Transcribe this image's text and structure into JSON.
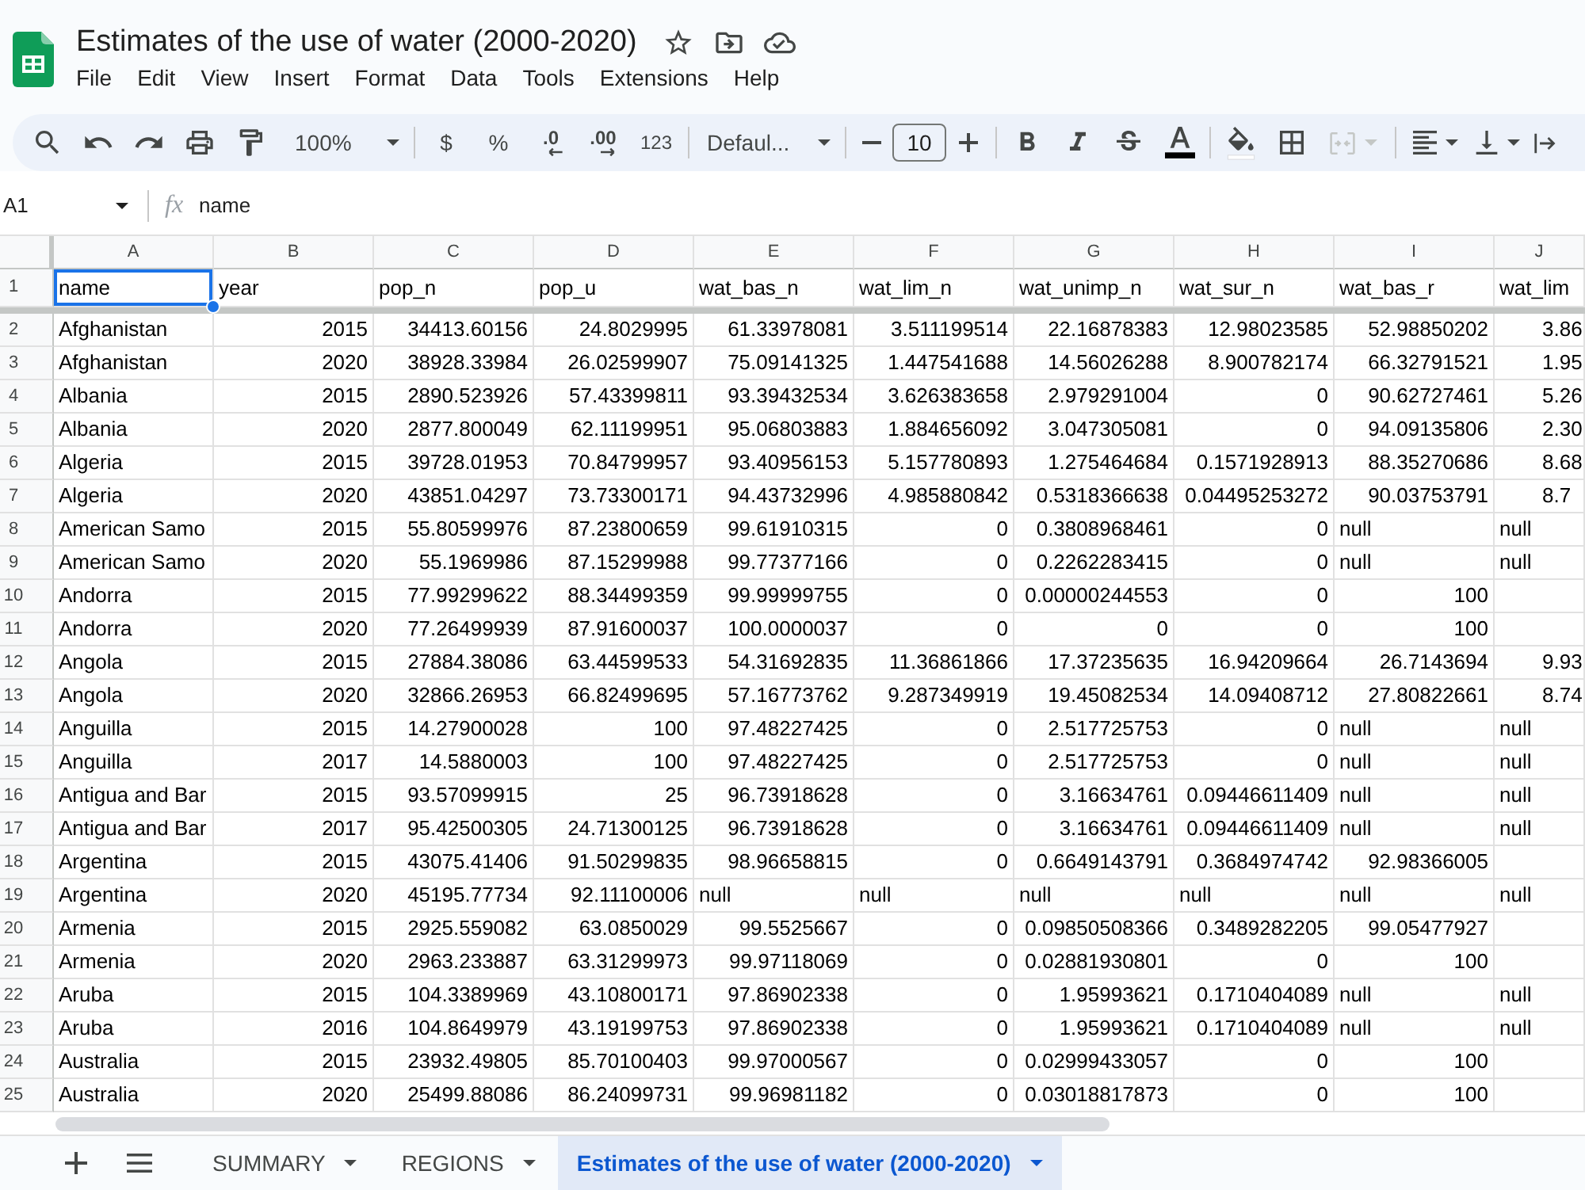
{
  "title_bar": {
    "title": "Estimates of the use of water (2000-2020)",
    "menu": [
      "File",
      "Edit",
      "View",
      "Insert",
      "Format",
      "Data",
      "Tools",
      "Extensions",
      "Help"
    ]
  },
  "toolbar": {
    "zoom": "100%",
    "currency": "$",
    "percent": "%",
    "decrease_decimal": ".0",
    "increase_decimal": ".00",
    "number_format": "123",
    "font": "Defaul...",
    "font_size": "10",
    "merge_cells": {
      "disabled": true
    }
  },
  "formula_bar": {
    "cell_reference": "A1",
    "function_label": "fx",
    "value": "name"
  },
  "grid": {
    "columns": [
      "A",
      "B",
      "C",
      "D",
      "E",
      "F",
      "G",
      "H",
      "I",
      "J"
    ],
    "rows": [
      {
        "number": "1",
        "cells": [
          {
            "text": "name",
            "kind": "text",
            "selected": true
          },
          {
            "text": "year",
            "kind": "text",
            "selected": false
          },
          {
            "text": "pop_n",
            "kind": "text",
            "selected": false
          },
          {
            "text": "pop_u",
            "kind": "text",
            "selected": false
          },
          {
            "text": "wat_bas_n",
            "kind": "text",
            "selected": false
          },
          {
            "text": "wat_lim_n",
            "kind": "text",
            "selected": false
          },
          {
            "text": "wat_unimp_n",
            "kind": "text",
            "selected": false
          },
          {
            "text": "wat_sur_n",
            "kind": "text",
            "selected": false
          },
          {
            "text": "wat_bas_r",
            "kind": "text",
            "selected": false
          },
          {
            "text": "wat_lim",
            "kind": "text",
            "selected": false
          }
        ]
      },
      {
        "number": "2",
        "cells": [
          {
            "text": "Afghanistan",
            "kind": "text",
            "selected": false
          },
          {
            "text": "2015",
            "kind": "number",
            "selected": false
          },
          {
            "text": "34413.60156",
            "kind": "number",
            "selected": false
          },
          {
            "text": "24.8029995",
            "kind": "number",
            "selected": false
          },
          {
            "text": "61.33978081",
            "kind": "number",
            "selected": false
          },
          {
            "text": "3.511199514",
            "kind": "number",
            "selected": false
          },
          {
            "text": "22.16878383",
            "kind": "number",
            "selected": false
          },
          {
            "text": "12.98023585",
            "kind": "number",
            "selected": false
          },
          {
            "text": "52.98850202",
            "kind": "number",
            "selected": false
          },
          {
            "text": "3.86",
            "kind": "number",
            "selected": false
          }
        ]
      },
      {
        "number": "3",
        "cells": [
          {
            "text": "Afghanistan",
            "kind": "text",
            "selected": false
          },
          {
            "text": "2020",
            "kind": "number",
            "selected": false
          },
          {
            "text": "38928.33984",
            "kind": "number",
            "selected": false
          },
          {
            "text": "26.02599907",
            "kind": "number",
            "selected": false
          },
          {
            "text": "75.09141325",
            "kind": "number",
            "selected": false
          },
          {
            "text": "1.447541688",
            "kind": "number",
            "selected": false
          },
          {
            "text": "14.56026288",
            "kind": "number",
            "selected": false
          },
          {
            "text": "8.900782174",
            "kind": "number",
            "selected": false
          },
          {
            "text": "66.32791521",
            "kind": "number",
            "selected": false
          },
          {
            "text": "1.95",
            "kind": "number",
            "selected": false
          }
        ]
      },
      {
        "number": "4",
        "cells": [
          {
            "text": "Albania",
            "kind": "text",
            "selected": false
          },
          {
            "text": "2015",
            "kind": "number",
            "selected": false
          },
          {
            "text": "2890.523926",
            "kind": "number",
            "selected": false
          },
          {
            "text": "57.43399811",
            "kind": "number",
            "selected": false
          },
          {
            "text": "93.39432534",
            "kind": "number",
            "selected": false
          },
          {
            "text": "3.626383658",
            "kind": "number",
            "selected": false
          },
          {
            "text": "2.979291004",
            "kind": "number",
            "selected": false
          },
          {
            "text": "0",
            "kind": "number",
            "selected": false
          },
          {
            "text": "90.62727461",
            "kind": "number",
            "selected": false
          },
          {
            "text": "5.26",
            "kind": "number",
            "selected": false
          }
        ]
      },
      {
        "number": "5",
        "cells": [
          {
            "text": "Albania",
            "kind": "text",
            "selected": false
          },
          {
            "text": "2020",
            "kind": "number",
            "selected": false
          },
          {
            "text": "2877.800049",
            "kind": "number",
            "selected": false
          },
          {
            "text": "62.11199951",
            "kind": "number",
            "selected": false
          },
          {
            "text": "95.06803883",
            "kind": "number",
            "selected": false
          },
          {
            "text": "1.884656092",
            "kind": "number",
            "selected": false
          },
          {
            "text": "3.047305081",
            "kind": "number",
            "selected": false
          },
          {
            "text": "0",
            "kind": "number",
            "selected": false
          },
          {
            "text": "94.09135806",
            "kind": "number",
            "selected": false
          },
          {
            "text": "2.30",
            "kind": "number",
            "selected": false
          }
        ]
      },
      {
        "number": "6",
        "cells": [
          {
            "text": "Algeria",
            "kind": "text",
            "selected": false
          },
          {
            "text": "2015",
            "kind": "number",
            "selected": false
          },
          {
            "text": "39728.01953",
            "kind": "number",
            "selected": false
          },
          {
            "text": "70.84799957",
            "kind": "number",
            "selected": false
          },
          {
            "text": "93.40956153",
            "kind": "number",
            "selected": false
          },
          {
            "text": "5.157780893",
            "kind": "number",
            "selected": false
          },
          {
            "text": "1.275464684",
            "kind": "number",
            "selected": false
          },
          {
            "text": "0.1571928913",
            "kind": "number",
            "selected": false
          },
          {
            "text": "88.35270686",
            "kind": "number",
            "selected": false
          },
          {
            "text": "8.68",
            "kind": "number",
            "selected": false
          }
        ]
      },
      {
        "number": "7",
        "cells": [
          {
            "text": "Algeria",
            "kind": "text",
            "selected": false
          },
          {
            "text": "2020",
            "kind": "number",
            "selected": false
          },
          {
            "text": "43851.04297",
            "kind": "number",
            "selected": false
          },
          {
            "text": "73.73300171",
            "kind": "number",
            "selected": false
          },
          {
            "text": "94.43732996",
            "kind": "number",
            "selected": false
          },
          {
            "text": "4.985880842",
            "kind": "number",
            "selected": false
          },
          {
            "text": "0.5318366638",
            "kind": "number",
            "selected": false
          },
          {
            "text": "0.04495253272",
            "kind": "number",
            "selected": false
          },
          {
            "text": "90.03753791",
            "kind": "number",
            "selected": false
          },
          {
            "text": "8.7",
            "kind": "number",
            "selected": false
          }
        ]
      },
      {
        "number": "8",
        "cells": [
          {
            "text": "American Samo",
            "kind": "text",
            "selected": false
          },
          {
            "text": "2015",
            "kind": "number",
            "selected": false
          },
          {
            "text": "55.80599976",
            "kind": "number",
            "selected": false
          },
          {
            "text": "87.23800659",
            "kind": "number",
            "selected": false
          },
          {
            "text": "99.61910315",
            "kind": "number",
            "selected": false
          },
          {
            "text": "0",
            "kind": "number",
            "selected": false
          },
          {
            "text": "0.3808968461",
            "kind": "number",
            "selected": false
          },
          {
            "text": "0",
            "kind": "number",
            "selected": false
          },
          {
            "text": "null",
            "kind": "text",
            "selected": false
          },
          {
            "text": "null",
            "kind": "text",
            "selected": false
          }
        ]
      },
      {
        "number": "9",
        "cells": [
          {
            "text": "American Samo",
            "kind": "text",
            "selected": false
          },
          {
            "text": "2020",
            "kind": "number",
            "selected": false
          },
          {
            "text": "55.1969986",
            "kind": "number",
            "selected": false
          },
          {
            "text": "87.15299988",
            "kind": "number",
            "selected": false
          },
          {
            "text": "99.77377166",
            "kind": "number",
            "selected": false
          },
          {
            "text": "0",
            "kind": "number",
            "selected": false
          },
          {
            "text": "0.2262283415",
            "kind": "number",
            "selected": false
          },
          {
            "text": "0",
            "kind": "number",
            "selected": false
          },
          {
            "text": "null",
            "kind": "text",
            "selected": false
          },
          {
            "text": "null",
            "kind": "text",
            "selected": false
          }
        ]
      },
      {
        "number": "10",
        "cells": [
          {
            "text": "Andorra",
            "kind": "text",
            "selected": false
          },
          {
            "text": "2015",
            "kind": "number",
            "selected": false
          },
          {
            "text": "77.99299622",
            "kind": "number",
            "selected": false
          },
          {
            "text": "88.34499359",
            "kind": "number",
            "selected": false
          },
          {
            "text": "99.99999755",
            "kind": "number",
            "selected": false
          },
          {
            "text": "0",
            "kind": "number",
            "selected": false
          },
          {
            "text": "0.00000244553",
            "kind": "number",
            "selected": false
          },
          {
            "text": "0",
            "kind": "number",
            "selected": false
          },
          {
            "text": "100",
            "kind": "number",
            "selected": false
          }
        ]
      },
      {
        "number": "11",
        "cells": [
          {
            "text": "Andorra",
            "kind": "text",
            "selected": false
          },
          {
            "text": "2020",
            "kind": "number",
            "selected": false
          },
          {
            "text": "77.26499939",
            "kind": "number",
            "selected": false
          },
          {
            "text": "87.91600037",
            "kind": "number",
            "selected": false
          },
          {
            "text": "100.0000037",
            "kind": "number",
            "selected": false
          },
          {
            "text": "0",
            "kind": "number",
            "selected": false
          },
          {
            "text": "0",
            "kind": "number",
            "selected": false
          },
          {
            "text": "0",
            "kind": "number",
            "selected": false
          },
          {
            "text": "100",
            "kind": "number",
            "selected": false
          }
        ]
      },
      {
        "number": "12",
        "cells": [
          {
            "text": "Angola",
            "kind": "text",
            "selected": false
          },
          {
            "text": "2015",
            "kind": "number",
            "selected": false
          },
          {
            "text": "27884.38086",
            "kind": "number",
            "selected": false
          },
          {
            "text": "63.44599533",
            "kind": "number",
            "selected": false
          },
          {
            "text": "54.31692835",
            "kind": "number",
            "selected": false
          },
          {
            "text": "11.36861866",
            "kind": "number",
            "selected": false
          },
          {
            "text": "17.37235635",
            "kind": "number",
            "selected": false
          },
          {
            "text": "16.94209664",
            "kind": "number",
            "selected": false
          },
          {
            "text": "26.7143694",
            "kind": "number",
            "selected": false
          },
          {
            "text": "9.93",
            "kind": "number",
            "selected": false
          }
        ]
      },
      {
        "number": "13",
        "cells": [
          {
            "text": "Angola",
            "kind": "text",
            "selected": false
          },
          {
            "text": "2020",
            "kind": "number",
            "selected": false
          },
          {
            "text": "32866.26953",
            "kind": "number",
            "selected": false
          },
          {
            "text": "66.82499695",
            "kind": "number",
            "selected": false
          },
          {
            "text": "57.16773762",
            "kind": "number",
            "selected": false
          },
          {
            "text": "9.287349919",
            "kind": "number",
            "selected": false
          },
          {
            "text": "19.45082534",
            "kind": "number",
            "selected": false
          },
          {
            "text": "14.09408712",
            "kind": "number",
            "selected": false
          },
          {
            "text": "27.80822661",
            "kind": "number",
            "selected": false
          },
          {
            "text": "8.74",
            "kind": "number",
            "selected": false
          }
        ]
      },
      {
        "number": "14",
        "cells": [
          {
            "text": "Anguilla",
            "kind": "text",
            "selected": false
          },
          {
            "text": "2015",
            "kind": "number",
            "selected": false
          },
          {
            "text": "14.27900028",
            "kind": "number",
            "selected": false
          },
          {
            "text": "100",
            "kind": "number",
            "selected": false
          },
          {
            "text": "97.48227425",
            "kind": "number",
            "selected": false
          },
          {
            "text": "0",
            "kind": "number",
            "selected": false
          },
          {
            "text": "2.517725753",
            "kind": "number",
            "selected": false
          },
          {
            "text": "0",
            "kind": "number",
            "selected": false
          },
          {
            "text": "null",
            "kind": "text",
            "selected": false
          },
          {
            "text": "null",
            "kind": "text",
            "selected": false
          }
        ]
      },
      {
        "number": "15",
        "cells": [
          {
            "text": "Anguilla",
            "kind": "text",
            "selected": false
          },
          {
            "text": "2017",
            "kind": "number",
            "selected": false
          },
          {
            "text": "14.5880003",
            "kind": "number",
            "selected": false
          },
          {
            "text": "100",
            "kind": "number",
            "selected": false
          },
          {
            "text": "97.48227425",
            "kind": "number",
            "selected": false
          },
          {
            "text": "0",
            "kind": "number",
            "selected": false
          },
          {
            "text": "2.517725753",
            "kind": "number",
            "selected": false
          },
          {
            "text": "0",
            "kind": "number",
            "selected": false
          },
          {
            "text": "null",
            "kind": "text",
            "selected": false
          },
          {
            "text": "null",
            "kind": "text",
            "selected": false
          }
        ]
      },
      {
        "number": "16",
        "cells": [
          {
            "text": "Antigua and Bar",
            "kind": "text",
            "selected": false
          },
          {
            "text": "2015",
            "kind": "number",
            "selected": false
          },
          {
            "text": "93.57099915",
            "kind": "number",
            "selected": false
          },
          {
            "text": "25",
            "kind": "number",
            "selected": false
          },
          {
            "text": "96.73918628",
            "kind": "number",
            "selected": false
          },
          {
            "text": "0",
            "kind": "number",
            "selected": false
          },
          {
            "text": "3.16634761",
            "kind": "number",
            "selected": false
          },
          {
            "text": "0.09446611409",
            "kind": "number",
            "selected": false
          },
          {
            "text": "null",
            "kind": "text",
            "selected": false
          },
          {
            "text": "null",
            "kind": "text",
            "selected": false
          }
        ]
      },
      {
        "number": "17",
        "cells": [
          {
            "text": "Antigua and Bar",
            "kind": "text",
            "selected": false
          },
          {
            "text": "2017",
            "kind": "number",
            "selected": false
          },
          {
            "text": "95.42500305",
            "kind": "number",
            "selected": false
          },
          {
            "text": "24.71300125",
            "kind": "number",
            "selected": false
          },
          {
            "text": "96.73918628",
            "kind": "number",
            "selected": false
          },
          {
            "text": "0",
            "kind": "number",
            "selected": false
          },
          {
            "text": "3.16634761",
            "kind": "number",
            "selected": false
          },
          {
            "text": "0.09446611409",
            "kind": "number",
            "selected": false
          },
          {
            "text": "null",
            "kind": "text",
            "selected": false
          },
          {
            "text": "null",
            "kind": "text",
            "selected": false
          }
        ]
      },
      {
        "number": "18",
        "cells": [
          {
            "text": "Argentina",
            "kind": "text",
            "selected": false
          },
          {
            "text": "2015",
            "kind": "number",
            "selected": false
          },
          {
            "text": "43075.41406",
            "kind": "number",
            "selected": false
          },
          {
            "text": "91.50299835",
            "kind": "number",
            "selected": false
          },
          {
            "text": "98.96658815",
            "kind": "number",
            "selected": false
          },
          {
            "text": "0",
            "kind": "number",
            "selected": false
          },
          {
            "text": "0.6649143791",
            "kind": "number",
            "selected": false
          },
          {
            "text": "0.3684974742",
            "kind": "number",
            "selected": false
          },
          {
            "text": "92.98366005",
            "kind": "number",
            "selected": false
          }
        ]
      },
      {
        "number": "19",
        "cells": [
          {
            "text": "Argentina",
            "kind": "text",
            "selected": false
          },
          {
            "text": "2020",
            "kind": "number",
            "selected": false
          },
          {
            "text": "45195.77734",
            "kind": "number",
            "selected": false
          },
          {
            "text": "92.11100006",
            "kind": "number",
            "selected": false
          },
          {
            "text": "null",
            "kind": "text",
            "selected": false
          },
          {
            "text": "null",
            "kind": "text",
            "selected": false
          },
          {
            "text": "null",
            "kind": "text",
            "selected": false
          },
          {
            "text": "null",
            "kind": "text",
            "selected": false
          },
          {
            "text": "null",
            "kind": "text",
            "selected": false
          },
          {
            "text": "null",
            "kind": "text",
            "selected": false
          }
        ]
      },
      {
        "number": "20",
        "cells": [
          {
            "text": "Armenia",
            "kind": "text",
            "selected": false
          },
          {
            "text": "2015",
            "kind": "number",
            "selected": false
          },
          {
            "text": "2925.559082",
            "kind": "number",
            "selected": false
          },
          {
            "text": "63.0850029",
            "kind": "number",
            "selected": false
          },
          {
            "text": "99.5525667",
            "kind": "number",
            "selected": false
          },
          {
            "text": "0",
            "kind": "number",
            "selected": false
          },
          {
            "text": "0.09850508366",
            "kind": "number",
            "selected": false
          },
          {
            "text": "0.3489282205",
            "kind": "number",
            "selected": false
          },
          {
            "text": "99.05477927",
            "kind": "number",
            "selected": false
          }
        ]
      },
      {
        "number": "21",
        "cells": [
          {
            "text": "Armenia",
            "kind": "text",
            "selected": false
          },
          {
            "text": "2020",
            "kind": "number",
            "selected": false
          },
          {
            "text": "2963.233887",
            "kind": "number",
            "selected": false
          },
          {
            "text": "63.31299973",
            "kind": "number",
            "selected": false
          },
          {
            "text": "99.97118069",
            "kind": "number",
            "selected": false
          },
          {
            "text": "0",
            "kind": "number",
            "selected": false
          },
          {
            "text": "0.02881930801",
            "kind": "number",
            "selected": false
          },
          {
            "text": "0",
            "kind": "number",
            "selected": false
          },
          {
            "text": "100",
            "kind": "number",
            "selected": false
          }
        ]
      },
      {
        "number": "22",
        "cells": [
          {
            "text": "Aruba",
            "kind": "text",
            "selected": false
          },
          {
            "text": "2015",
            "kind": "number",
            "selected": false
          },
          {
            "text": "104.3389969",
            "kind": "number",
            "selected": false
          },
          {
            "text": "43.10800171",
            "kind": "number",
            "selected": false
          },
          {
            "text": "97.86902338",
            "kind": "number",
            "selected": false
          },
          {
            "text": "0",
            "kind": "number",
            "selected": false
          },
          {
            "text": "1.95993621",
            "kind": "number",
            "selected": false
          },
          {
            "text": "0.1710404089",
            "kind": "number",
            "selected": false
          },
          {
            "text": "null",
            "kind": "text",
            "selected": false
          },
          {
            "text": "null",
            "kind": "text",
            "selected": false
          }
        ]
      },
      {
        "number": "23",
        "cells": [
          {
            "text": "Aruba",
            "kind": "text",
            "selected": false
          },
          {
            "text": "2016",
            "kind": "number",
            "selected": false
          },
          {
            "text": "104.8649979",
            "kind": "number",
            "selected": false
          },
          {
            "text": "43.19199753",
            "kind": "number",
            "selected": false
          },
          {
            "text": "97.86902338",
            "kind": "number",
            "selected": false
          },
          {
            "text": "0",
            "kind": "number",
            "selected": false
          },
          {
            "text": "1.95993621",
            "kind": "number",
            "selected": false
          },
          {
            "text": "0.1710404089",
            "kind": "number",
            "selected": false
          },
          {
            "text": "null",
            "kind": "text",
            "selected": false
          },
          {
            "text": "null",
            "kind": "text",
            "selected": false
          }
        ]
      },
      {
        "number": "24",
        "cells": [
          {
            "text": "Australia",
            "kind": "text",
            "selected": false
          },
          {
            "text": "2015",
            "kind": "number",
            "selected": false
          },
          {
            "text": "23932.49805",
            "kind": "number",
            "selected": false
          },
          {
            "text": "85.70100403",
            "kind": "number",
            "selected": false
          },
          {
            "text": "99.97000567",
            "kind": "number",
            "selected": false
          },
          {
            "text": "0",
            "kind": "number",
            "selected": false
          },
          {
            "text": "0.02999433057",
            "kind": "number",
            "selected": false
          },
          {
            "text": "0",
            "kind": "number",
            "selected": false
          },
          {
            "text": "100",
            "kind": "number",
            "selected": false
          }
        ]
      },
      {
        "number": "25",
        "cells": [
          {
            "text": "Australia",
            "kind": "text",
            "selected": false
          },
          {
            "text": "2020",
            "kind": "number",
            "selected": false
          },
          {
            "text": "25499.88086",
            "kind": "number",
            "selected": false
          },
          {
            "text": "86.24099731",
            "kind": "number",
            "selected": false
          },
          {
            "text": "99.96981182",
            "kind": "number",
            "selected": false
          },
          {
            "text": "0",
            "kind": "number",
            "selected": false
          },
          {
            "text": "0.03018817873",
            "kind": "number",
            "selected": false
          },
          {
            "text": "0",
            "kind": "number",
            "selected": false
          },
          {
            "text": "100",
            "kind": "number",
            "selected": false
          }
        ]
      }
    ]
  },
  "sheet_tabs": [
    {
      "label": "SUMMARY",
      "selected": false
    },
    {
      "label": "REGIONS",
      "selected": false
    },
    {
      "label": "Estimates of the use of water (2000-2020)",
      "selected": true
    }
  ]
}
